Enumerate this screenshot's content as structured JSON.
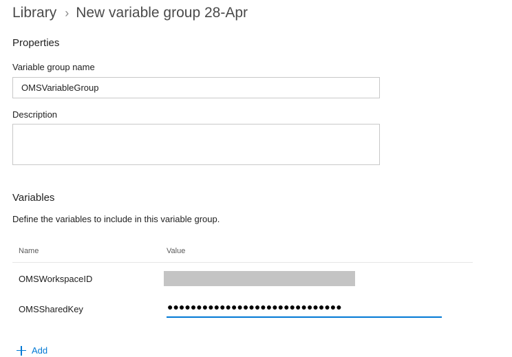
{
  "breadcrumb": {
    "root": "Library",
    "separator_icon": "chevron-right-icon",
    "current": "New variable group 28-Apr"
  },
  "properties": {
    "title": "Properties",
    "name_label": "Variable group name",
    "name_value": "OMSVariableGroup",
    "description_label": "Description",
    "description_value": ""
  },
  "variables": {
    "title": "Variables",
    "helper": "Define the variables to include in this variable group.",
    "columns": {
      "name": "Name",
      "value": "Value"
    },
    "rows": [
      {
        "name": "OMSWorkspaceID",
        "value_state": "redacted"
      },
      {
        "name": "OMSSharedKey",
        "value_state": "secret",
        "masked_value": "●●●●●●●●●●●●●●●●●●●●●●●●●●●●●●"
      }
    ],
    "add_label": "Add",
    "add_icon": "plus-icon"
  },
  "colors": {
    "accent": "#0078d4",
    "border": "#c8c8c8",
    "redaction": "#c4c4c4"
  }
}
